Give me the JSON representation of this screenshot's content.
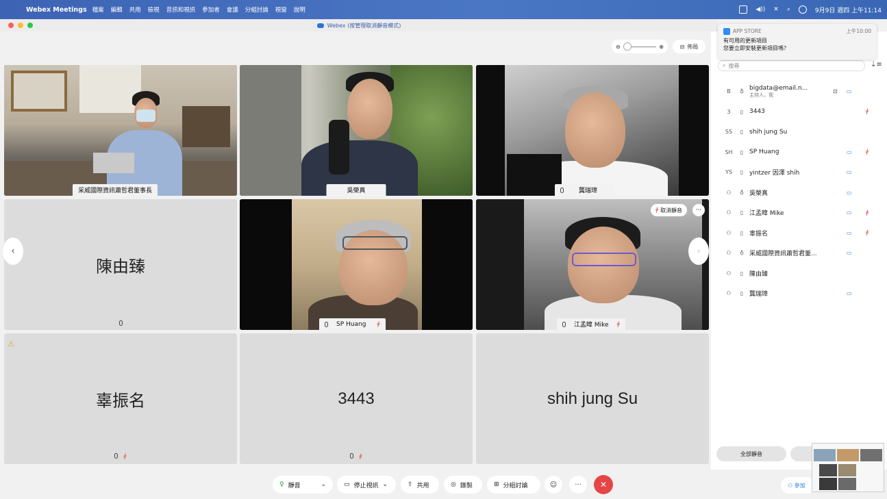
{
  "menubar": {
    "app_name": "Webex Meetings",
    "items": [
      "檔案",
      "編輯",
      "共用",
      "檢視",
      "音訊和視訊",
      "參加者",
      "會議",
      "分組討論",
      "視窗",
      "說明"
    ],
    "clock": "9月9日 週四 上午11:14"
  },
  "window": {
    "title": "Webex (按管理取消靜音模式)"
  },
  "toolbar": {
    "layout_label": "佈局"
  },
  "tiles": [
    {
      "name": "采威國際資訊蕭哲君董事長",
      "type": "video"
    },
    {
      "name": "吳榮真",
      "type": "video"
    },
    {
      "name": "龔瑞璋",
      "type": "video"
    },
    {
      "name": "陳由臻",
      "type": "avatar"
    },
    {
      "name": "SP Huang",
      "type": "video"
    },
    {
      "name": "江孟暐 Mike",
      "type": "video",
      "unmute_label": "取消靜音"
    },
    {
      "name": "辜振名",
      "type": "avatar"
    },
    {
      "name": "3443",
      "type": "avatar"
    },
    {
      "name": "shih jung Su",
      "type": "avatar"
    }
  ],
  "notification": {
    "app": "APP STORE",
    "time": "上午10:00",
    "title": "有可用的更新項目",
    "body": "您要立即安裝更新項目嗎？"
  },
  "panel": {
    "search_placeholder": "搜尋",
    "participants": [
      {
        "avatar": "B",
        "name": "bigdata@email.n...",
        "sub": "主持人，我",
        "camera": true,
        "share": true,
        "muted": false
      },
      {
        "avatar": "3",
        "name": "3443",
        "sub": "",
        "camera": false,
        "muted": true
      },
      {
        "avatar": "SS",
        "name": "shih jung Su",
        "sub": "",
        "camera": false,
        "muted": false
      },
      {
        "avatar": "SH",
        "name": "SP Huang",
        "sub": "",
        "camera": true,
        "muted": true
      },
      {
        "avatar": "YS",
        "name": "yintzer 因澤 shih",
        "sub": "",
        "camera": true,
        "muted": false
      },
      {
        "avatar": "person",
        "name": "吳榮真",
        "sub": "",
        "camera": true,
        "muted": false
      },
      {
        "avatar": "person",
        "name": "江孟暐 Mike",
        "sub": "",
        "camera": true,
        "muted": true
      },
      {
        "avatar": "person",
        "name": "辜振名",
        "sub": "",
        "camera": true,
        "muted": true
      },
      {
        "avatar": "person",
        "name": "采威國際資訊蕭哲君董...",
        "sub": "",
        "camera": true,
        "muted": false
      },
      {
        "avatar": "person",
        "name": "陳由臻",
        "sub": "",
        "camera": false,
        "muted": false
      },
      {
        "avatar": "person",
        "name": "龔瑞璋",
        "sub": "",
        "camera": true,
        "muted": false
      }
    ],
    "mute_all_label": "全部靜音",
    "participants_button": "參加"
  },
  "controls": {
    "mute": "靜音",
    "stop_video": "停止視訊",
    "share": "共用",
    "record": "錄製",
    "breakout": "分組討論"
  }
}
